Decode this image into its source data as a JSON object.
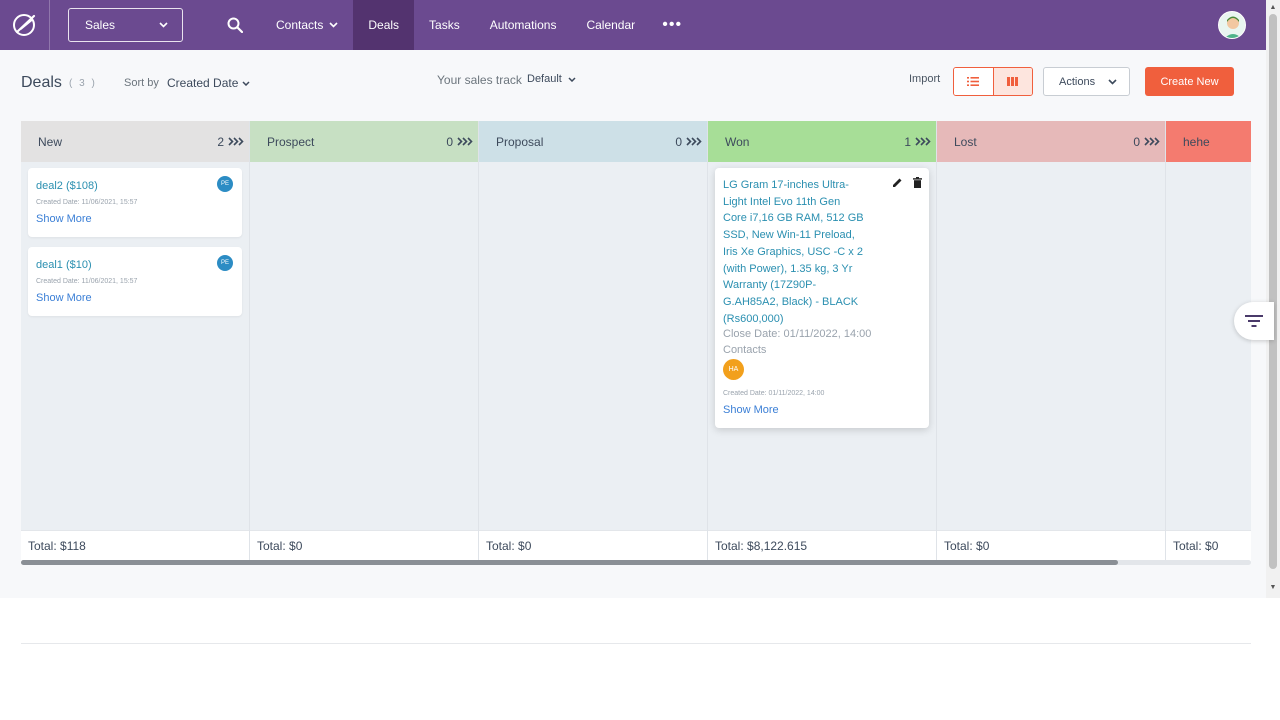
{
  "nav": {
    "app_selector": "Sales",
    "items": [
      {
        "label": "Contacts",
        "has_dropdown": true,
        "active": false
      },
      {
        "label": "Deals",
        "has_dropdown": false,
        "active": true
      },
      {
        "label": "Tasks",
        "has_dropdown": false,
        "active": false
      },
      {
        "label": "Automations",
        "has_dropdown": false,
        "active": false
      },
      {
        "label": "Calendar",
        "has_dropdown": false,
        "active": false
      }
    ],
    "more_label": "•••"
  },
  "header": {
    "title": "Deals",
    "count": "( 3 )",
    "sort_label": "Sort by",
    "sort_value": "Created Date",
    "track_label": "Your sales track",
    "track_value": "Default",
    "import_label": "Import",
    "actions_label": "Actions",
    "create_label": "Create New"
  },
  "board": {
    "columns": [
      {
        "name": "New",
        "count": "2",
        "color": "#e3e2e2",
        "total": "Total: $118"
      },
      {
        "name": "Prospect",
        "count": "0",
        "color": "#c7e0c3",
        "total": "Total: $0"
      },
      {
        "name": "Proposal",
        "count": "0",
        "color": "#cde0e7",
        "total": "Total: $0"
      },
      {
        "name": "Won",
        "count": "1",
        "color": "#a7de97",
        "total": "Total: $8,122.615"
      },
      {
        "name": "Lost",
        "count": "0",
        "color": "#e6b9b9",
        "total": "Total: $0"
      },
      {
        "name": "hehe",
        "count": "",
        "color": "#f47b6f",
        "total": "Total: $0"
      }
    ],
    "new_cards": [
      {
        "title": "deal2 ($108)",
        "created": "Created Date: 11/06/2021, 15:57",
        "more": "Show More",
        "owner": "PE"
      },
      {
        "title": "deal1 ($10)",
        "created": "Created Date: 11/06/2021, 15:57",
        "more": "Show More",
        "owner": "PE"
      }
    ],
    "won_card": {
      "title": "LG Gram 17-inches Ultra-Light Intel Evo 11th Gen Core i7,16 GB RAM, 512 GB SSD, New Win-11 Preload, Iris Xe Graphics, USC -C x 2 (with Power), 1.35 kg, 3 Yr Warranty (17Z90P-G.AH85A2, Black) - BLACK (Rs600,000)",
      "close_date": "Close Date: 01/11/2022, 14:00",
      "contacts_label": "Contacts",
      "contact": "HA",
      "created": "Created Date: 01/11/2022, 14:00",
      "more": "Show More"
    }
  },
  "colors": {
    "nav_bg": "#6b4a90",
    "nav_active": "#53336f",
    "accent": "#f05f3d",
    "link": "#2a8fb0"
  }
}
